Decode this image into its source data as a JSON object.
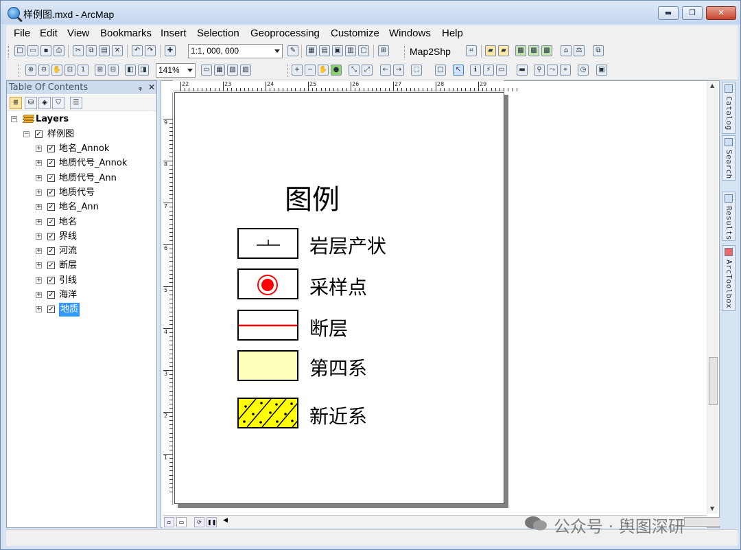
{
  "window": {
    "title": "样例图.mxd - ArcMap",
    "buttons": {
      "minimize": "▬",
      "maximize": "❐",
      "close": "✕"
    }
  },
  "menu": [
    "File",
    "Edit",
    "View",
    "Bookmarks",
    "Insert",
    "Selection",
    "Geoprocessing",
    "Customize",
    "Windows",
    "Help"
  ],
  "toolbar": {
    "scale": "1:1, 000, 000",
    "map2shp": "Map2Shp",
    "zoom": "141%"
  },
  "toc": {
    "header": "Table Of Contents",
    "pin": "ᵩ",
    "close": "✕",
    "root": "Layers",
    "dataframe": "样例图",
    "layers": [
      {
        "name": "地名_Annok",
        "checked": true,
        "selected": false
      },
      {
        "name": "地质代号_Annok",
        "checked": true,
        "selected": false
      },
      {
        "name": "地质代号_Ann",
        "checked": true,
        "selected": false
      },
      {
        "name": "地质代号",
        "checked": true,
        "selected": false
      },
      {
        "name": "地名_Ann",
        "checked": true,
        "selected": false
      },
      {
        "name": "地名",
        "checked": true,
        "selected": false
      },
      {
        "name": "界线",
        "checked": true,
        "selected": false
      },
      {
        "name": "河流",
        "checked": true,
        "selected": false
      },
      {
        "name": "断层",
        "checked": true,
        "selected": false
      },
      {
        "name": "引线",
        "checked": true,
        "selected": false
      },
      {
        "name": "海洋",
        "checked": true,
        "selected": false
      },
      {
        "name": "地质",
        "checked": true,
        "selected": true
      }
    ]
  },
  "ruler": {
    "top": [
      "22",
      "23",
      "24",
      "25",
      "26",
      "27",
      "28",
      "29"
    ],
    "left": [
      "9",
      "8",
      "7",
      "6",
      "5",
      "4",
      "3",
      "2",
      "1"
    ]
  },
  "legend": {
    "title": "图例",
    "items": [
      {
        "label": "岩层产状",
        "symbol": "strike-dip",
        "color": "#000000"
      },
      {
        "label": "采样点",
        "symbol": "sample-point",
        "color": "#ff0000"
      },
      {
        "label": "断层",
        "symbol": "fault-line",
        "color": "#ff0000"
      },
      {
        "label": "第四系",
        "symbol": "fill",
        "color": "#ffffbe"
      },
      {
        "label": "新近系",
        "symbol": "hatch-dots",
        "color": "#ffff00"
      }
    ]
  },
  "dock_tabs": [
    "Catalog",
    "Search",
    "Results",
    "ArcToolbox"
  ],
  "watermark": "公众号 · 舆图深研"
}
